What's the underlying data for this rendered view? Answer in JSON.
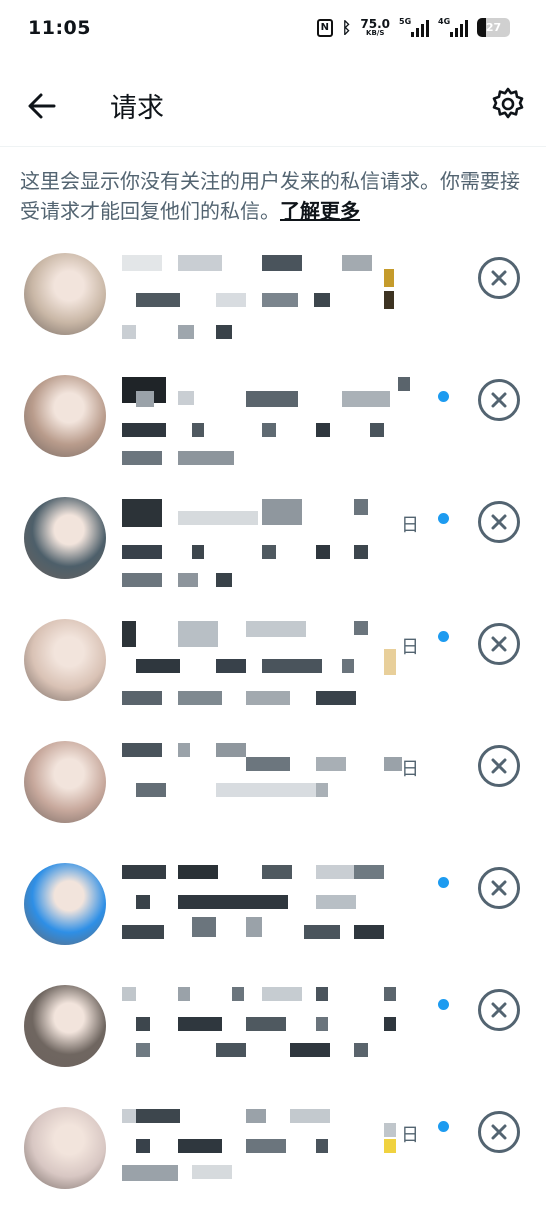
{
  "status": {
    "time": "11:05",
    "nfc": "N",
    "speed_value": "75.0",
    "speed_unit": "KB/S",
    "sim1": "5G",
    "sim2": "4G",
    "battery": "27"
  },
  "header": {
    "title": "请求",
    "back_icon": "arrow-left-icon",
    "settings_icon": "gear-icon"
  },
  "info": {
    "text": "这里会显示你没有关注的用户发来的私信请求。你需要接受请求才能回复他们的私信。",
    "link": "了解更多"
  },
  "requests": [
    {
      "date": "",
      "unread": false,
      "avatar_color": "#c9b7a6"
    },
    {
      "date": "",
      "unread": true,
      "avatar_color": "#b99c8c"
    },
    {
      "date": "日",
      "unread": true,
      "avatar_color": "#4d5f6a"
    },
    {
      "date": "日",
      "unread": true,
      "avatar_color": "#d9c2b5"
    },
    {
      "date": "日",
      "unread": false,
      "avatar_color": "#c7a89c"
    },
    {
      "date": "",
      "unread": true,
      "avatar_color": "#2e8fe6"
    },
    {
      "date": "",
      "unread": true,
      "avatar_color": "#6f6660"
    },
    {
      "date": "日",
      "unread": true,
      "avatar_color": "#d8c7c3"
    }
  ],
  "colors": {
    "accent": "#1d9bf0",
    "secondary_text": "#536471",
    "primary_text": "#0f1419"
  }
}
